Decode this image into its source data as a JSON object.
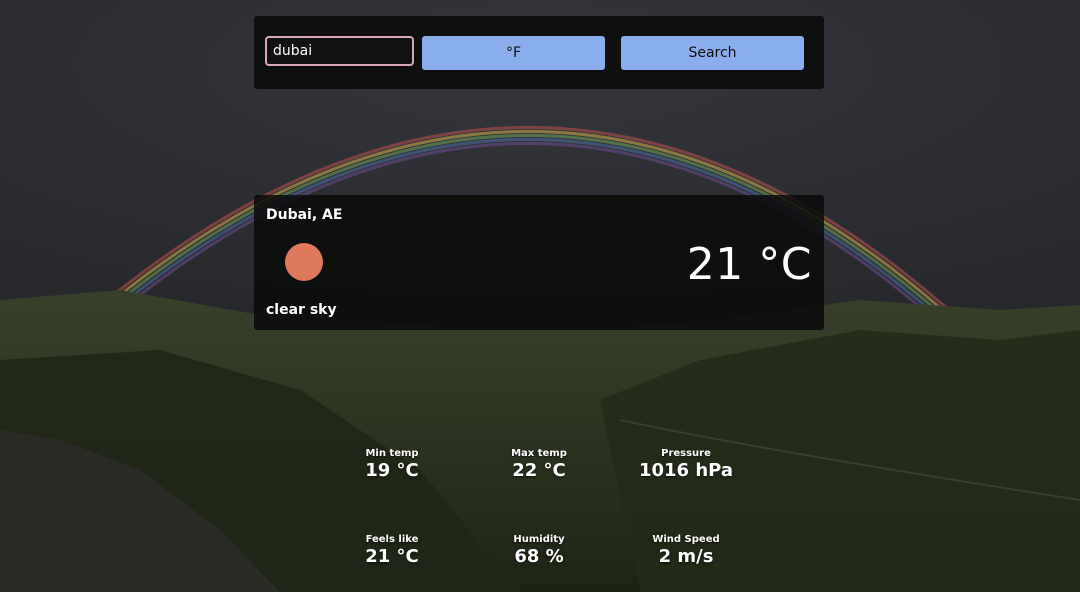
{
  "search": {
    "city_value": "dubai",
    "unit_toggle_label": "°F",
    "search_label": "Search"
  },
  "weather": {
    "location": "Dubai, AE",
    "temperature": "21 °C",
    "description": "clear sky",
    "icon": "sun-icon"
  },
  "stats": [
    {
      "label": "Min temp",
      "value": "19 °C"
    },
    {
      "label": "Max temp",
      "value": "22 °C"
    },
    {
      "label": "Pressure",
      "value": "1016 hPa"
    },
    {
      "label": "Feels like",
      "value": "21 °C"
    },
    {
      "label": "Humidity",
      "value": "68 %"
    },
    {
      "label": "Wind Speed",
      "value": "2 m/s"
    }
  ],
  "colors": {
    "button": "#8aaeec",
    "input_border": "#d9a7b5",
    "sun": "#e07a5f",
    "panel": "#0a0a0a"
  }
}
